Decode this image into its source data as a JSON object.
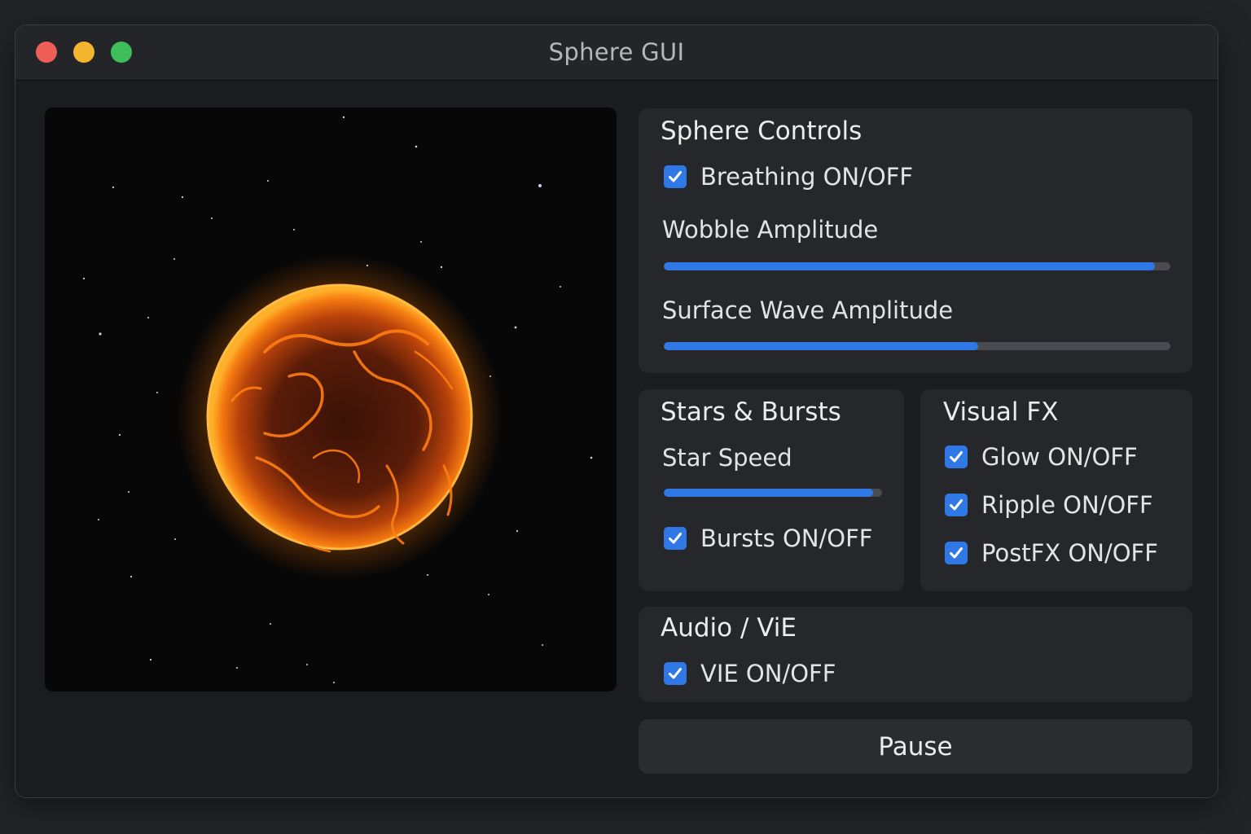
{
  "window": {
    "title": "Sphere GUI"
  },
  "sphere_controls": {
    "title": "Sphere Controls",
    "breathing": {
      "label": "Breathing ON/OFF",
      "checked": true
    },
    "wobble": {
      "label": "Wobble Amplitude",
      "value": 0.97
    },
    "surface_wave": {
      "label": "Surface Wave Amplitude",
      "value": 0.62
    }
  },
  "stars_bursts": {
    "title": "Stars & Bursts",
    "star_speed": {
      "label": "Star Speed",
      "value": 0.96
    },
    "bursts": {
      "label": "Bursts ON/OFF",
      "checked": true
    }
  },
  "visual_fx": {
    "title": "Visual FX",
    "glow": {
      "label": "Glow ON/OFF",
      "checked": true
    },
    "ripple": {
      "label": "Ripple ON/OFF",
      "checked": true
    },
    "postfx": {
      "label": "PostFX ON/OFF",
      "checked": true
    }
  },
  "audio": {
    "title": "Audio / ViE",
    "vie": {
      "label": "VIE ON/OFF",
      "checked": true
    }
  },
  "pause_button": {
    "label": "Pause"
  },
  "colors": {
    "accent": "#2f78e6",
    "sphere_glow": "#ffa21a",
    "sphere_body": "#4a1608"
  },
  "icons": {
    "checkbox": "check-icon",
    "traffic_lights": [
      "close-icon",
      "minimize-icon",
      "zoom-icon"
    ]
  }
}
